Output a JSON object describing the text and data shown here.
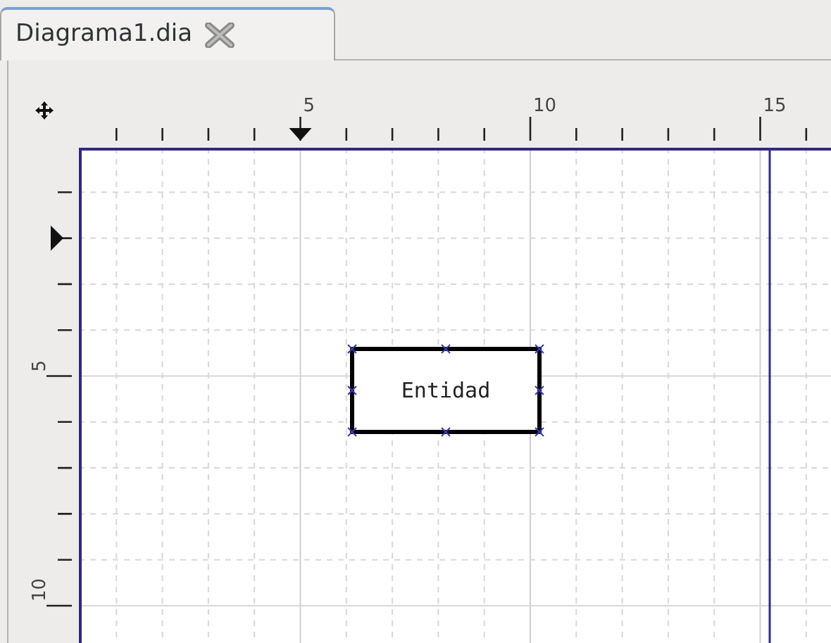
{
  "tab": {
    "label": "Diagrama1.dia",
    "selected": true
  },
  "ruler_top": {
    "labels": [
      "5",
      "10",
      "15"
    ]
  },
  "ruler_left": {
    "labels": [
      "5",
      "10"
    ]
  },
  "diagram": {
    "entities": [
      {
        "label": "Entidad"
      }
    ]
  }
}
